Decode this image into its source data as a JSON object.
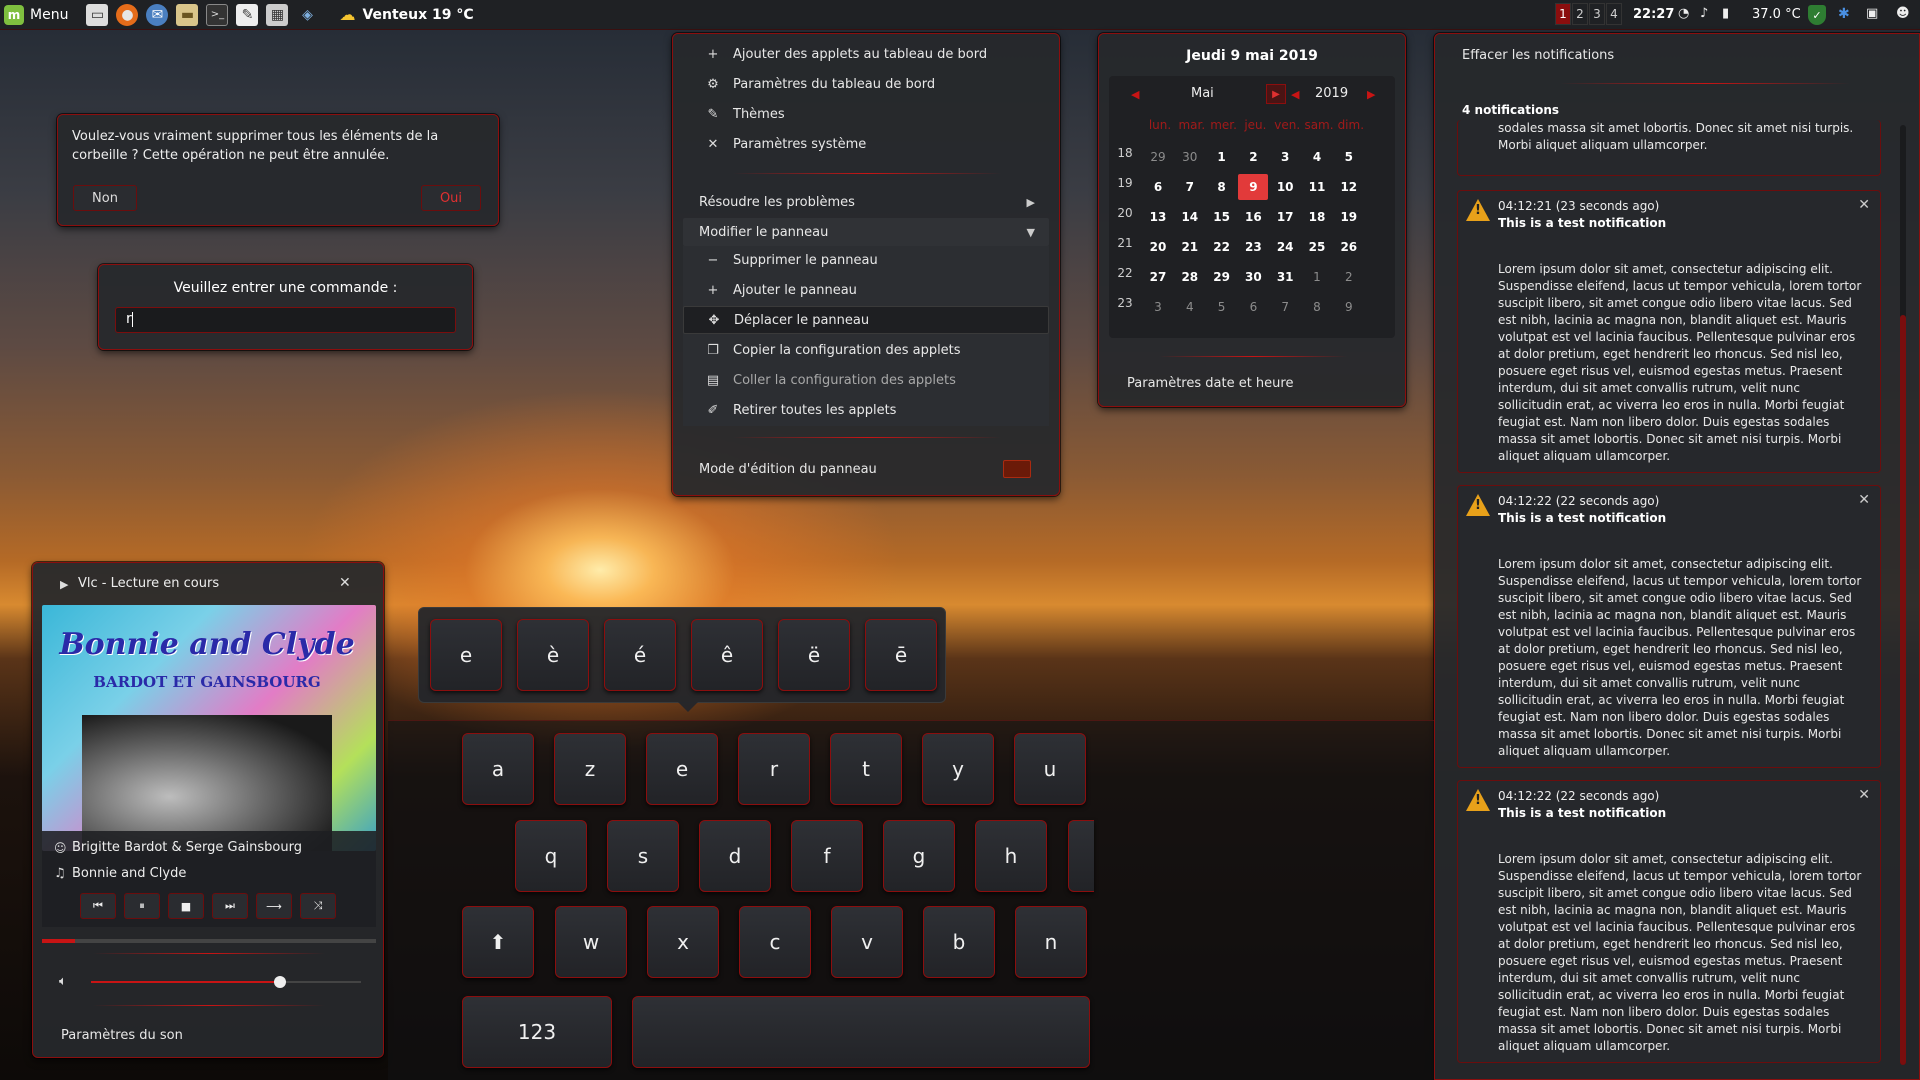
{
  "taskbar": {
    "menu_label": "Menu",
    "weather": "Venteux 19 °C",
    "workspaces": [
      "1",
      "2",
      "3",
      "4"
    ],
    "time": "22:27",
    "temperature": "37.0 °C"
  },
  "trash_dialog": {
    "message": "Voulez-vous vraiment supprimer tous les éléments de la corbeille ? Cette opération ne peut être annulée.",
    "no_label": "Non",
    "yes_label": "Oui"
  },
  "run_dialog": {
    "prompt": "Veuillez entrer une commande :",
    "value": "r"
  },
  "panel_menu": {
    "items_top": [
      {
        "icon": "plus-icon",
        "glyph": "+",
        "label": "Ajouter des applets au tableau de bord"
      },
      {
        "icon": "gear-icon",
        "glyph": "⚙",
        "label": "Paramètres du tableau de bord"
      },
      {
        "icon": "palette-icon",
        "glyph": "✎",
        "label": "Thèmes"
      },
      {
        "icon": "tools-icon",
        "glyph": "✕",
        "label": "Paramètres système"
      }
    ],
    "troubleshoot": "Résoudre les problèmes",
    "edit_panel": "Modifier le panneau",
    "items_sub": [
      {
        "icon": "minus-icon",
        "glyph": "−",
        "label": "Supprimer le panneau"
      },
      {
        "icon": "plus-icon",
        "glyph": "+",
        "label": "Ajouter le panneau"
      },
      {
        "icon": "move-icon",
        "glyph": "✥",
        "label": "Déplacer le panneau"
      },
      {
        "icon": "copy-icon",
        "glyph": "❐",
        "label": "Copier la configuration des applets"
      },
      {
        "icon": "paste-icon",
        "glyph": "▤",
        "label": "Coller la configuration des applets"
      },
      {
        "icon": "broom-icon",
        "glyph": "✐",
        "label": "Retirer toutes les applets"
      }
    ],
    "edit_mode": "Mode d'édition du panneau"
  },
  "calendar": {
    "title": "Jeudi 9 mai 2019",
    "month": "Mai",
    "year": "2019",
    "weekdays": [
      "lun.",
      "mar.",
      "mer.",
      "jeu.",
      "ven.",
      "sam.",
      "dim."
    ],
    "week_numbers": [
      "18",
      "19",
      "20",
      "21",
      "22",
      "23"
    ],
    "days": [
      [
        "29",
        "30",
        "1",
        "2",
        "3",
        "4",
        "5"
      ],
      [
        "6",
        "7",
        "8",
        "9",
        "10",
        "11",
        "12"
      ],
      [
        "13",
        "14",
        "15",
        "16",
        "17",
        "18",
        "19"
      ],
      [
        "20",
        "21",
        "22",
        "23",
        "24",
        "25",
        "26"
      ],
      [
        "27",
        "28",
        "29",
        "30",
        "31",
        "1",
        "2"
      ],
      [
        "3",
        "4",
        "5",
        "6",
        "7",
        "8",
        "9"
      ]
    ],
    "other_month_mask": [
      [
        1,
        1,
        0,
        0,
        0,
        0,
        0
      ],
      [
        0,
        0,
        0,
        0,
        0,
        0,
        0
      ],
      [
        0,
        0,
        0,
        0,
        0,
        0,
        0
      ],
      [
        0,
        0,
        0,
        0,
        0,
        0,
        0
      ],
      [
        0,
        0,
        0,
        0,
        0,
        1,
        1
      ],
      [
        1,
        1,
        1,
        1,
        1,
        1,
        1
      ]
    ],
    "today": "9",
    "settings_link": "Paramètres date et heure"
  },
  "notifications": {
    "clear_label": "Effacer les notifications",
    "count_label": "4 notifications",
    "partial_text": "sodales massa sit amet lobortis. Donec sit amet nisi turpis. Morbi aliquet aliquam ullamcorper.",
    "items": [
      {
        "time": "04:12:21 (23 seconds ago)",
        "title": "This is a test notification",
        "body": "Lorem ipsum dolor sit amet, consectetur adipiscing elit. Suspendisse eleifend, lacus ut tempor vehicula, lorem tortor suscipit libero, sit amet congue odio libero vitae lacus. Sed est nibh, lacinia ac magna non, blandit aliquet est. Mauris volutpat est vel lacinia faucibus. Pellentesque pulvinar eros at dolor pretium, eget hendrerit leo rhoncus. Sed nisl leo, posuere eget risus vel, euismod egestas metus. Praesent interdum, dui sit amet convallis rutrum, velit nunc sollicitudin erat, ac viverra leo eros in nulla. Morbi feugiat feugiat est. Nam non libero dolor. Duis egestas sodales massa sit amet lobortis. Donec sit amet nisi turpis. Morbi aliquet aliquam ullamcorper."
      },
      {
        "time": "04:12:22 (22 seconds ago)",
        "title": "This is a test notification",
        "body": "Lorem ipsum dolor sit amet, consectetur adipiscing elit. Suspendisse eleifend, lacus ut tempor vehicula, lorem tortor suscipit libero, sit amet congue odio libero vitae lacus. Sed est nibh, lacinia ac magna non, blandit aliquet est. Mauris volutpat est vel lacinia faucibus. Pellentesque pulvinar eros at dolor pretium, eget hendrerit leo rhoncus. Sed nisl leo, posuere eget risus vel, euismod egestas metus. Praesent interdum, dui sit amet convallis rutrum, velit nunc sollicitudin erat, ac viverra leo eros in nulla. Morbi feugiat feugiat est. Nam non libero dolor. Duis egestas sodales massa sit amet lobortis. Donec sit amet nisi turpis. Morbi aliquet aliquam ullamcorper."
      },
      {
        "time": "04:12:22 (22 seconds ago)",
        "title": "This is a test notification",
        "body": "Lorem ipsum dolor sit amet, consectetur adipiscing elit. Suspendisse eleifend, lacus ut tempor vehicula, lorem tortor suscipit libero, sit amet congue odio libero vitae lacus. Sed est nibh, lacinia ac magna non, blandit aliquet est. Mauris volutpat est vel lacinia faucibus. Pellentesque pulvinar eros at dolor pretium, eget hendrerit leo rhoncus. Sed nisl leo, posuere eget risus vel, euismod egestas metus. Praesent interdum, dui sit amet convallis rutrum, velit nunc sollicitudin erat, ac viverra leo eros in nulla. Morbi feugiat feugiat est. Nam non libero dolor. Duis egestas sodales massa sit amet lobortis. Donec sit amet nisi turpis. Morbi aliquet aliquam ullamcorper."
      }
    ]
  },
  "media_player": {
    "title": "Vlc - Lecture en cours",
    "album_art_text": "Bonnie and Clyde",
    "album_art_sub": "BARDOT ET GAINSBOURG",
    "artist": "Brigitte Bardot & Serge Gainsbourg",
    "track": "Bonnie and Clyde",
    "progress": 0.1,
    "volume": 0.7,
    "sound_settings": "Paramètres du son"
  },
  "keyboard": {
    "accent_popup": [
      "e",
      "è",
      "é",
      "ê",
      "ë",
      "ē"
    ],
    "row1": [
      "a",
      "z",
      "e",
      "r",
      "t",
      "y",
      "u"
    ],
    "row2": [
      "q",
      "s",
      "d",
      "f",
      "g",
      "h"
    ],
    "row3": [
      "w",
      "x",
      "c",
      "v",
      "b",
      "n"
    ],
    "shift": "⬆",
    "numbers_key": "123"
  },
  "colors": {
    "accent": "#c81414",
    "panel": "#26282c",
    "today": "#e23a3a"
  }
}
